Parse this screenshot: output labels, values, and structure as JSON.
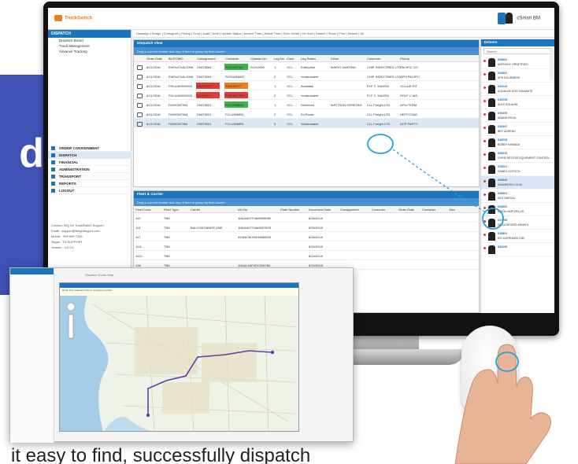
{
  "promo": {
    "letter": "d"
  },
  "app": {
    "user_label": "cSmart BM",
    "sidebar": {
      "header": "DISPATCH",
      "tree": [
        "Dispatch Board",
        "Track Management",
        "Advance Tracking"
      ],
      "menu": [
        "ORDER CONSIGNMENT",
        "DISPATCH",
        "FINANCIAL",
        "ADMINISTRATION",
        "TRANSPORT",
        "REPORTS",
        "LOGOUT"
      ],
      "active_menu": "DISPATCH",
      "info": [
        "Contact: 99() for TruckSwitch Support",
        "Email : support@freightmypro.com",
        "Mobile : 999 999 7346",
        "Skype : TS SUPPORT",
        "Version : 4.0.0.1"
      ]
    },
    "toolbar_text": "Unassign | Bridge | Consignee | Pickup | Drop | Audit | Note | Update Status | Invoice Time | Actual Time | Exec Detail | On Hold | Detach | Show | Print | Search | All",
    "dispatch": {
      "title": "Dispatch View",
      "group_hint": "Drag a column header and drop it here to group by that column",
      "columns": [
        "Order Date",
        "BL/POWO",
        "Consignment",
        "Container",
        "Chassis No",
        "Leg No",
        "Color",
        "Leg Status",
        "Driver",
        "Customer",
        "Pickup"
      ],
      "rows": [
        {
          "date": "6/11/2016",
          "bl": "EMSUCHAL2006",
          "cons": "D0875064",
          "cont": "TCNU98762",
          "chassis": "SCHU000",
          "leg": "1",
          "color": "YCL",
          "status": "Enterprise",
          "driver": "MARIO SANTINO",
          "customer": "CHIP INDEXTRIES LTD",
          "pickup": "PACIFIC CO"
        },
        {
          "date": "6/11/2016",
          "bl": "EMSUCHAL2008",
          "cons": "D0875064",
          "cont": "SCHU456087",
          "chassis": "",
          "leg": "2",
          "color": "YCL",
          "status": "Yardmarable",
          "driver": "",
          "customer": "CHIP INDEXTRIES LTD",
          "pickup": "APM PACIFIC"
        },
        {
          "date": "6/11/2016",
          "bl": "PVLUAW000003",
          "cons": "D0875071",
          "cont": "TCNU0977",
          "chassis": "",
          "leg": "1",
          "color": "YCL",
          "status": "Available",
          "driver": "",
          "customer": "PLF C. HAGEN",
          "pickup": "YOLAIR PIT"
        },
        {
          "date": "6/11/2016",
          "bl": "PVLUAW000003",
          "cons": "D0875071",
          "cont": "TCNU877963",
          "chassis": "",
          "leg": "2",
          "color": "YCL",
          "status": "Yardmarable",
          "driver": "",
          "customer": "PLF C. HAGEN",
          "pickup": "ROLF C MA"
        },
        {
          "date": "6/11/2016",
          "bl": "FASHD87064",
          "cons": "D0875001",
          "cont": "FCLU898851",
          "chassis": "",
          "leg": "1",
          "color": "YCL",
          "status": "Delivered",
          "driver": "MATTSON GEREZAS",
          "customer": "CLL Freight LTD",
          "pickup": "APM TERM"
        },
        {
          "date": "6/11/2016",
          "bl": "FASHD87064",
          "cons": "D0875001",
          "cont": "FCLU898851",
          "chassis": "",
          "leg": "2",
          "color": "YCL",
          "status": "En Route",
          "driver": "",
          "customer": "CLL Freight LTD",
          "pickup": "HEFFCOAS"
        },
        {
          "date": "6/11/2016",
          "bl": "FASHD87064",
          "cons": "D0875001",
          "cont": "FCLU898851",
          "chassis": "",
          "leg": "3",
          "color": "YCL",
          "status": "Yardmarable",
          "driver": "",
          "customer": "CLL Freight LTD",
          "pickup": "DCP PARTY"
        }
      ]
    },
    "fleet": {
      "title": "Fleet & Carrier",
      "group_hint": "Drag a column header and drop it here to group by that column",
      "columns": [
        "Fleet Code",
        "Fleet Type",
        "Carrier",
        "Vin No",
        "Plate Number",
        "Document Date",
        "Consignment",
        "Customer",
        "Order Date",
        "Container",
        "Size"
      ],
      "rows": [
        {
          "code": "112",
          "type": "TNK",
          "carrier": "",
          "vin": "1M1AN07Y4AM008980",
          "date": "8/26/2016"
        },
        {
          "code": "114",
          "type": "TNK",
          "carrier": "BALCONTAINER LINE",
          "vin": "1M1AN07Y4AM007878",
          "date": "8/26/2016"
        },
        {
          "code": "117",
          "type": "TNK",
          "carrier": "",
          "vin": "4V4NC9EH5DN588833",
          "date": "8/26/2016"
        },
        {
          "code": "1111",
          "type": "TNK",
          "carrier": "",
          "vin": "",
          "date": "8/15/2016"
        },
        {
          "code": "1122",
          "type": "TNK",
          "carrier": "",
          "vin": "",
          "date": "8/15/2016"
        },
        {
          "code": "108",
          "type": "TNK",
          "carrier": "",
          "vin": "1N4AL3AP4DC908784",
          "date": "8/15/2016"
        }
      ]
    },
    "drivers": {
      "title": "Drivers",
      "search_placeholder": "Search",
      "list": [
        {
          "id": "D98861",
          "name": "ANTHONY ORNETRIED"
        },
        {
          "id": "D94861",
          "name": "APH KOURMEDS"
        },
        {
          "id": "D91045",
          "name": "AQUALUS DOS SANJANTE"
        },
        {
          "id": "D38758",
          "name": "ALEX SOLAHID"
        },
        {
          "id": "D94455",
          "name": "ANAND ROUS"
        },
        {
          "id": "D30997",
          "name": "BEC ADRENG"
        },
        {
          "id": "D48798",
          "name": "BOBBY HAMADA"
        },
        {
          "id": "D89045",
          "name": "CHRIS RECESS EQUIPMENT CONTROL"
        },
        {
          "id": "D28007",
          "name": "DANIEL KOTOCH"
        },
        {
          "id": "D89845",
          "name": "DHANEESH LOUIS"
        },
        {
          "id": "D38901",
          "name": "DEX GARCIA"
        },
        {
          "id": "D89851",
          "name": "DWOLLHUR DELLIS"
        },
        {
          "id": "D19768",
          "name": "DEGLERGARD ZENATH"
        },
        {
          "id": "D38851",
          "name": "EN GOERHARD LNE"
        },
        {
          "id": "D81090",
          "name": ""
        }
      ],
      "selected_index": 9
    }
  },
  "map_window": {
    "note": "Dispatch Route Map",
    "info_line": "Route from selected order to consignee location"
  },
  "caption": "it easy to find, successfully dispatch"
}
